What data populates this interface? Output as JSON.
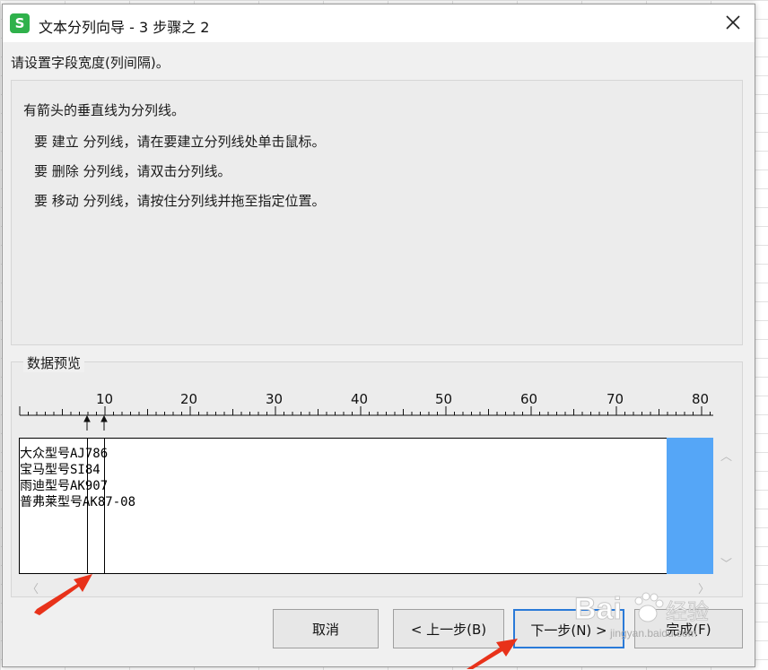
{
  "window": {
    "title": "文本分列向导 - 3 步骤之 2",
    "app_icon_letter": "S"
  },
  "instruction": "请设置字段宽度(列间隔)。",
  "info": {
    "line1": "有箭头的垂直线为分列线。",
    "line2": "要 建立 分列线，请在要建立分列线处单击鼠标。",
    "line3": "要 删除 分列线，请双击分列线。",
    "line4": "要 移动 分列线，请按住分列线并拖至指定位置。"
  },
  "preview": {
    "label": "数据预览",
    "ruler_numbers": [
      "10",
      "20",
      "30",
      "40",
      "50",
      "60",
      "70",
      "80"
    ],
    "rows": [
      "大众型号AJ786",
      "宝马型号SI84",
      "雨迪型号AK907",
      "普弗莱型号AK87-08"
    ]
  },
  "buttons": {
    "cancel": "取消",
    "back": "< 上一步(B)",
    "next": "下一步(N) >",
    "finish": "完成(F)"
  },
  "watermark": {
    "brand": "Bai",
    "brand2": "经验",
    "url": "jingyan.baidu.com"
  },
  "colors": {
    "accent": "#2a7ad8",
    "preview_highlight": "#55a6f7",
    "annotation_arrow": "#e8321a",
    "app_icon": "#2fb14b"
  }
}
